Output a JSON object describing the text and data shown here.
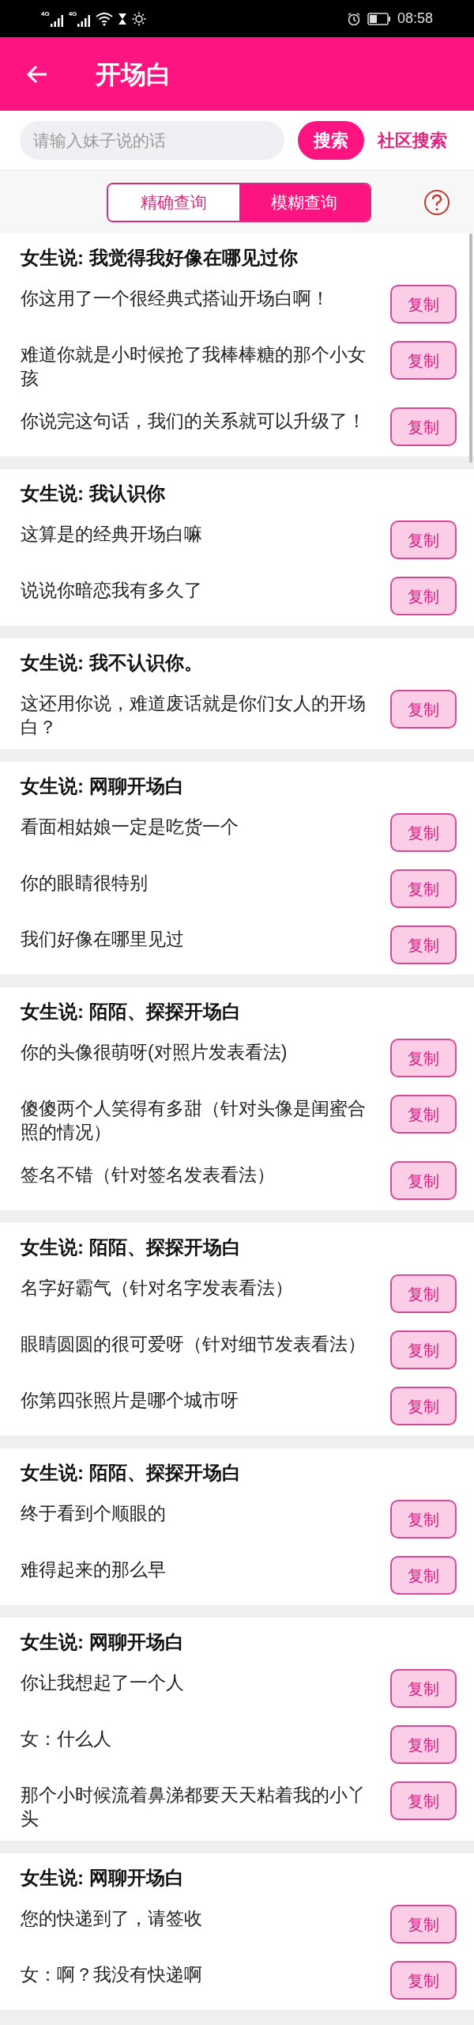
{
  "status_bar": {
    "networks": [
      {
        "label": "4G"
      },
      {
        "label": "4G"
      }
    ],
    "time": "08:58"
  },
  "header": {
    "title": "开场白"
  },
  "search": {
    "placeholder": "请输入妹子说的话",
    "button": "搜索",
    "community_link": "社区搜索"
  },
  "modes": [
    {
      "label": "精确查询",
      "selected": false
    },
    {
      "label": "模糊查询",
      "selected": true
    }
  ],
  "groups": [
    {
      "title": "女生说: 我觉得我好像在哪见过你",
      "replies": [
        {
          "text": "你这用了一个很经典式搭讪开场白啊！",
          "button": "复制"
        },
        {
          "text": "难道你就是小时候抢了我棒棒糖的那个小女孩",
          "button": "复制"
        },
        {
          "text": "你说完这句话，我们的关系就可以升级了！",
          "button": "复制"
        }
      ]
    },
    {
      "title": "女生说: 我认识你",
      "replies": [
        {
          "text": "这算是的经典开场白嘛",
          "button": "复制"
        },
        {
          "text": "说说你暗恋我有多久了",
          "button": "复制"
        }
      ]
    },
    {
      "title": "女生说: 我不认识你。",
      "replies": [
        {
          "text": "这还用你说，难道废话就是你们女人的开场白？",
          "button": "复制"
        }
      ]
    },
    {
      "title": "女生说: 网聊开场白",
      "replies": [
        {
          "text": "看面相姑娘一定是吃货一个",
          "button": "复制"
        },
        {
          "text": "你的眼睛很特别",
          "button": "复制"
        },
        {
          "text": "我们好像在哪里见过",
          "button": "复制"
        }
      ]
    },
    {
      "title": "女生说: 陌陌、探探开场白",
      "replies": [
        {
          "text": "你的头像很萌呀(对照片发表看法)",
          "button": "复制"
        },
        {
          "text": "傻傻两个人笑得有多甜（针对头像是闺蜜合照的情况）",
          "button": "复制"
        },
        {
          "text": "签名不错（针对签名发表看法）",
          "button": "复制"
        }
      ]
    },
    {
      "title": "女生说: 陌陌、探探开场白",
      "replies": [
        {
          "text": "名字好霸气（针对名字发表看法）",
          "button": "复制"
        },
        {
          "text": "眼睛圆圆的很可爱呀（针对细节发表看法）",
          "button": "复制"
        },
        {
          "text": "你第四张照片是哪个城市呀",
          "button": "复制"
        }
      ]
    },
    {
      "title": "女生说: 陌陌、探探开场白",
      "replies": [
        {
          "text": "终于看到个顺眼的",
          "button": "复制"
        },
        {
          "text": "难得起来的那么早",
          "button": "复制"
        }
      ]
    },
    {
      "title": "女生说: 网聊开场白",
      "replies": [
        {
          "text": "你让我想起了一个人",
          "button": "复制"
        },
        {
          "text": "女：什么人",
          "button": "复制"
        },
        {
          "text": "那个小时候流着鼻涕都要天天粘着我的小丫头",
          "button": "复制"
        }
      ]
    },
    {
      "title": "女生说: 网聊开场白",
      "replies": [
        {
          "text": "您的快递到了，请签收",
          "button": "复制"
        },
        {
          "text": "女：啊？我没有快递啊",
          "button": "复制"
        }
      ]
    }
  ]
}
